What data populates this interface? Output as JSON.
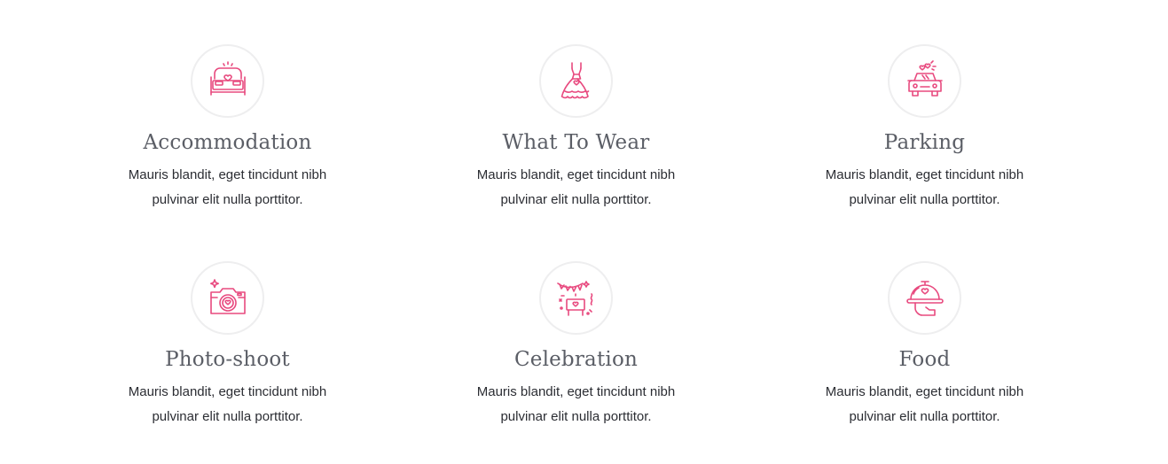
{
  "accent_color": "#e84a7f",
  "features": [
    {
      "title": "Accommodation",
      "description": "Mauris blandit, eget tincidunt nibh pulvinar elit nulla porttitor.",
      "icon": "bed-icon"
    },
    {
      "title": "What To Wear",
      "description": "Mauris blandit, eget tincidunt nibh pulvinar elit nulla porttitor.",
      "icon": "dress-icon"
    },
    {
      "title": "Parking",
      "description": "Mauris blandit, eget tincidunt nibh pulvinar elit nulla porttitor.",
      "icon": "car-icon"
    },
    {
      "title": "Photo-shoot",
      "description": "Mauris blandit, eget tincidunt nibh pulvinar elit nulla porttitor.",
      "icon": "camera-icon"
    },
    {
      "title": "Celebration",
      "description": "Mauris blandit, eget tincidunt nibh pulvinar elit nulla porttitor.",
      "icon": "celebration-icon"
    },
    {
      "title": "Food",
      "description": "Mauris blandit, eget tincidunt nibh pulvinar elit nulla porttitor.",
      "icon": "food-cloche-icon"
    }
  ]
}
